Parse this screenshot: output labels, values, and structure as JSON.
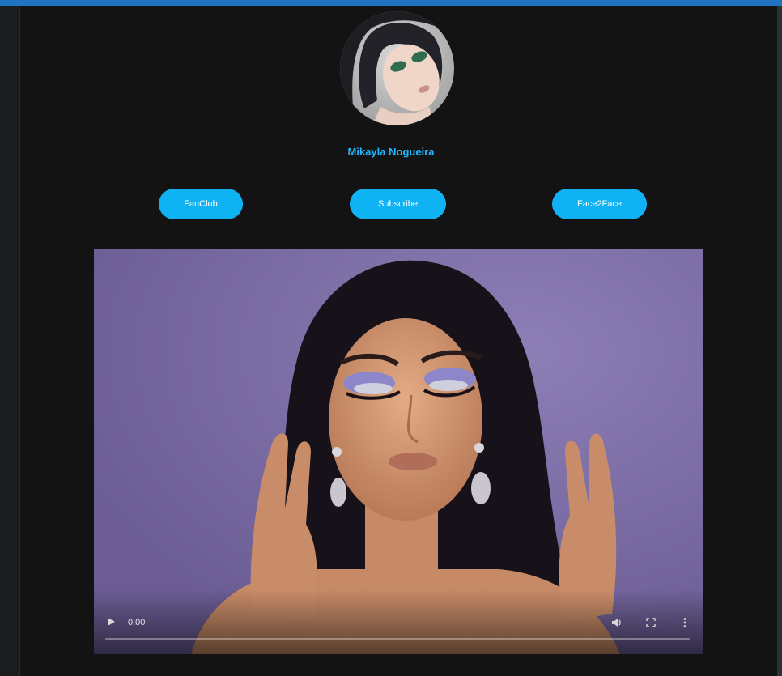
{
  "profile": {
    "name": "Mikayla Nogueira"
  },
  "buttons": {
    "fanclub": "FanClub",
    "subscribe": "Subscribe",
    "face2face": "Face2Face"
  },
  "video": {
    "current_time": "0:00",
    "progress": 0
  },
  "colors": {
    "accent": "#0fb3f4",
    "name_text": "#1fb6ff",
    "top_bar": "#1f74c2",
    "background": "#131313",
    "video_backdrop": "#7e6ea8"
  },
  "icons": {
    "play": "play-icon",
    "volume": "volume-icon",
    "fullscreen": "fullscreen-icon",
    "more": "more-vertical-icon"
  }
}
